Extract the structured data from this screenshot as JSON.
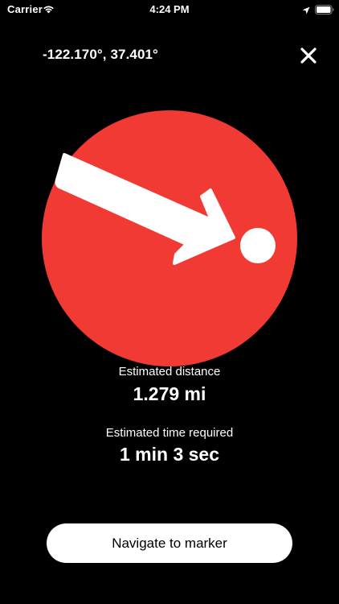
{
  "status_bar": {
    "carrier": "Carrier",
    "time": "4:24 PM",
    "icons": [
      "wifi-icon",
      "location-arrow-icon",
      "battery-icon"
    ]
  },
  "header": {
    "coordinates": "-122.170°, 37.401°",
    "close_icon": "close-icon"
  },
  "direction": {
    "circle_color": "#F03A33",
    "marker_color": "#FFFFFF",
    "icon": "direction-arrow-icon"
  },
  "estimates": {
    "distance_label": "Estimated distance",
    "distance_value": "1.279 mi",
    "time_label": "Estimated time required",
    "time_value": "1 min 3 sec"
  },
  "actions": {
    "navigate_label": "Navigate to marker"
  }
}
